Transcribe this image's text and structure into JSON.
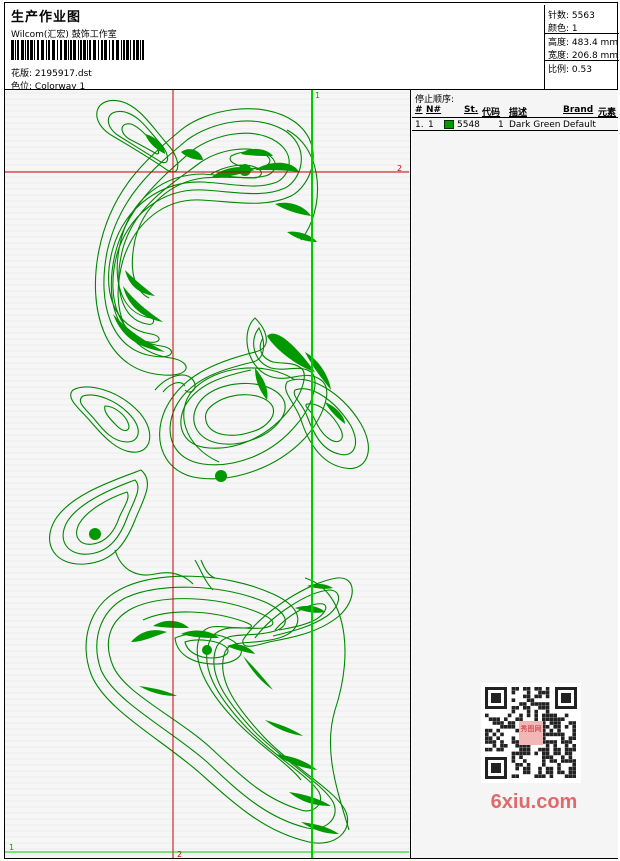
{
  "header": {
    "title": "生产作业图",
    "subtitle": "Wilcom(汇宏) 鼓饰工作室",
    "design_label": "花版:",
    "design_value": "2195917.dst",
    "colorway_label": "色位:",
    "colorway_value": "Colorway 1"
  },
  "stats": {
    "stitches_label": "针数:",
    "stitches_value": "5563",
    "colors_label": "颜色:",
    "colors_value": "1",
    "height_label": "高度:",
    "height_value": "483.4 mm",
    "width_label": "宽度:",
    "width_value": "206.8 mm",
    "scale_label": "比例:",
    "scale_value": "0.53"
  },
  "guides": {
    "top_label": "1",
    "right_label": "2",
    "bottom_label": "2",
    "left_label": "1"
  },
  "stop_sequence": {
    "title": "停止顺序:",
    "columns": [
      "#",
      "N#",
      "St.",
      "代码",
      "描述",
      "Brand",
      "元素"
    ],
    "rows": [
      {
        "index": "1.",
        "n": "1",
        "stitches": "5548",
        "code": "1",
        "description": "Dark Green",
        "brand": "Default",
        "element": ""
      }
    ],
    "swatch_color": "#009900"
  },
  "design": {
    "thread_color": "#008800",
    "fill_color": "#009900",
    "guide_red": "#cc0000",
    "guide_green": "#00cc00"
  },
  "watermark": {
    "text": "6xiu.com",
    "stamp": "秀图网"
  }
}
